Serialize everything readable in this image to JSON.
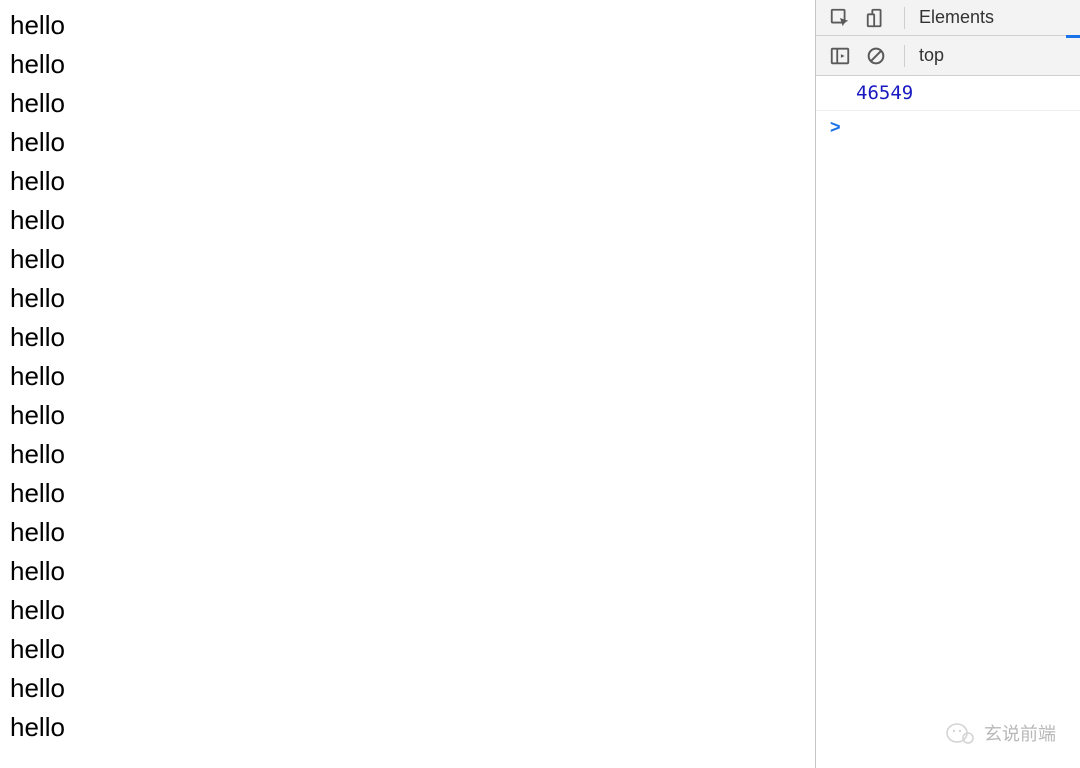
{
  "page": {
    "line_text": "hello",
    "line_count": 19
  },
  "devtools": {
    "tabs": {
      "elements": "Elements"
    },
    "console": {
      "context": "top",
      "output": "46549",
      "prompt": ">"
    }
  },
  "watermark": {
    "text": "玄说前端"
  }
}
